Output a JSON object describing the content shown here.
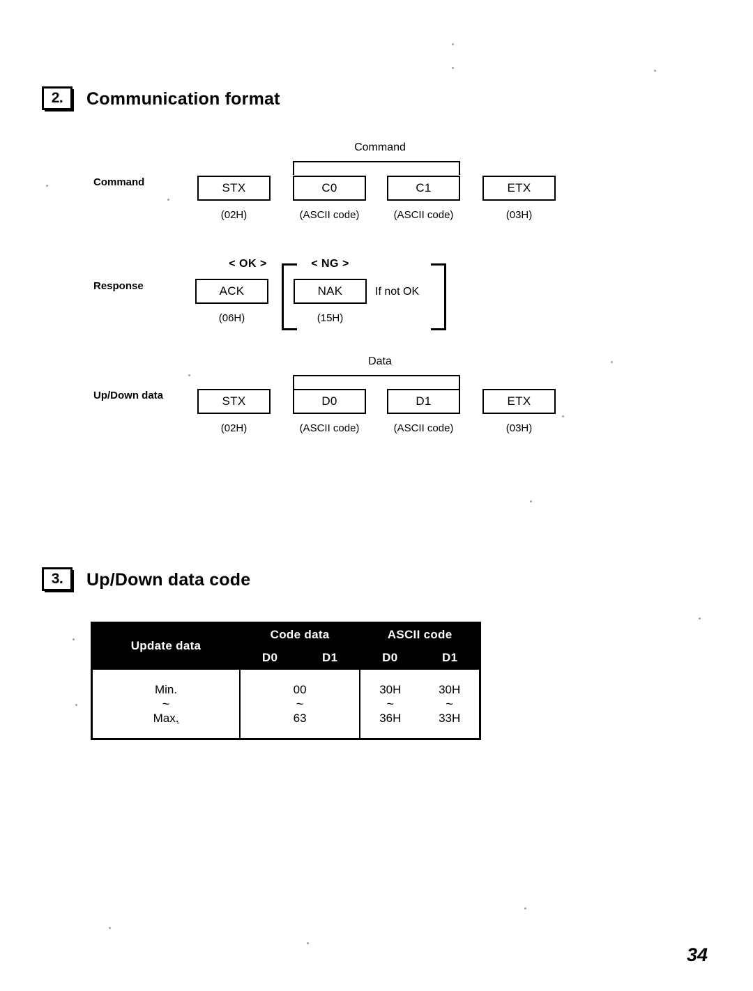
{
  "page": {
    "number": "34"
  },
  "sections": [
    {
      "number": "2.",
      "title": "Communication format"
    },
    {
      "number": "3.",
      "title": "Up/Down data code"
    }
  ],
  "diagrams": {
    "command": {
      "row_label": "Command",
      "bracket_label": "Command",
      "boxes": [
        {
          "name": "stx",
          "label": "STX",
          "sub": "(02H)"
        },
        {
          "name": "c0",
          "label": "C0",
          "sub": "(ASCII code)"
        },
        {
          "name": "c1",
          "label": "C1",
          "sub": "(ASCII code)"
        },
        {
          "name": "etx",
          "label": "ETX",
          "sub": "(03H)"
        }
      ]
    },
    "response": {
      "row_label": "Response",
      "ok_label": "< OK >",
      "ng_label": "< NG >",
      "note": "If not OK",
      "boxes": [
        {
          "name": "ack",
          "label": "ACK",
          "sub": "(06H)"
        },
        {
          "name": "nak",
          "label": "NAK",
          "sub": "(15H)"
        }
      ]
    },
    "updown": {
      "row_label": "Up/Down data",
      "bracket_label": "Data",
      "boxes": [
        {
          "name": "stx",
          "label": "STX",
          "sub": "(02H)"
        },
        {
          "name": "d0",
          "label": "D0",
          "sub": "(ASCII code)"
        },
        {
          "name": "d1",
          "label": "D1",
          "sub": "(ASCII code)"
        },
        {
          "name": "etx",
          "label": "ETX",
          "sub": "(03H)"
        }
      ]
    }
  },
  "table": {
    "headers": {
      "update_data": "Update data",
      "code_data": "Code data",
      "ascii_code": "ASCII code",
      "d0": "D0",
      "d1": "D1"
    },
    "rows": {
      "update": {
        "min": "Min.",
        "tilde": "~",
        "max": "Max."
      },
      "code": {
        "min": "00",
        "tilde": "~",
        "max": "63"
      },
      "ascii_d0": {
        "min": "30H",
        "tilde": "~",
        "max": "36H"
      },
      "ascii_d1": {
        "min": "30H",
        "tilde": "~",
        "max": "33H"
      }
    }
  }
}
